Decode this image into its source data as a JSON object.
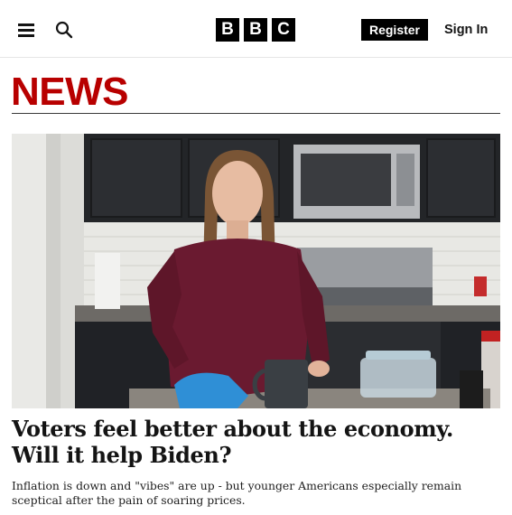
{
  "header": {
    "logo_letters": [
      "B",
      "B",
      "C"
    ],
    "register_label": "Register",
    "signin_label": "Sign In"
  },
  "section": {
    "title": "NEWS",
    "color": "#b80000"
  },
  "article": {
    "headline": "Voters feel better about the economy. Will it help Biden?",
    "summary": "Inflation is down and \"vibes\" are up - but younger Americans especially remain sceptical after the pain of soaring prices."
  },
  "icons": {
    "menu": "hamburger-menu-icon",
    "search": "search-icon"
  }
}
